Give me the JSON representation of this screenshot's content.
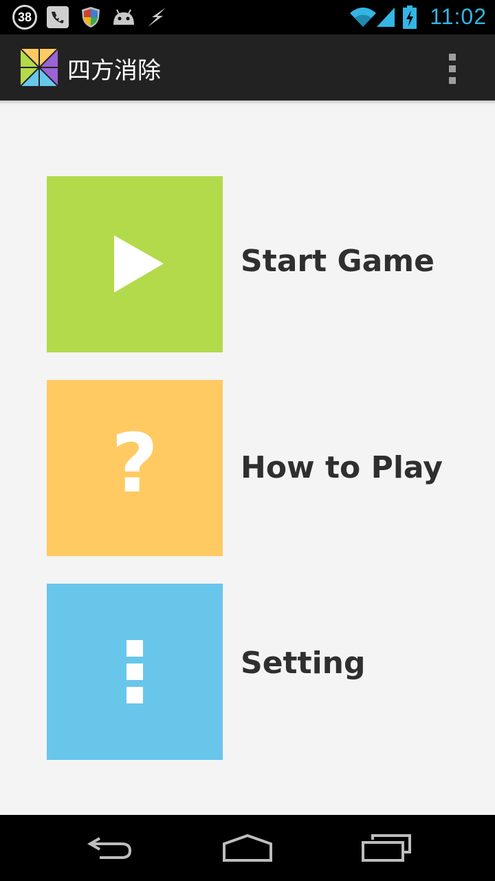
{
  "statusbar": {
    "notification_count": "38",
    "time": "11:02",
    "icons": [
      "notification-count-badge",
      "phone-bird-icon",
      "shield-icon",
      "android-icon",
      "flash-icon",
      "wifi-icon",
      "signal-icon",
      "battery-charging-icon"
    ]
  },
  "actionbar": {
    "title": "四方消除",
    "logo": "app-logo-icon",
    "overflow": "overflow-menu-icon"
  },
  "menu": {
    "items": [
      {
        "label": "Start Game",
        "icon": "play-icon",
        "color": "#b3da4b"
      },
      {
        "label": "How to Play",
        "icon": "question-icon",
        "color": "#ffca62",
        "glyph": "?"
      },
      {
        "label": "Setting",
        "icon": "dots-icon",
        "color": "#68c6eb"
      }
    ]
  },
  "navbar": {
    "icons": [
      "back-icon",
      "home-icon",
      "recent-apps-icon"
    ]
  }
}
